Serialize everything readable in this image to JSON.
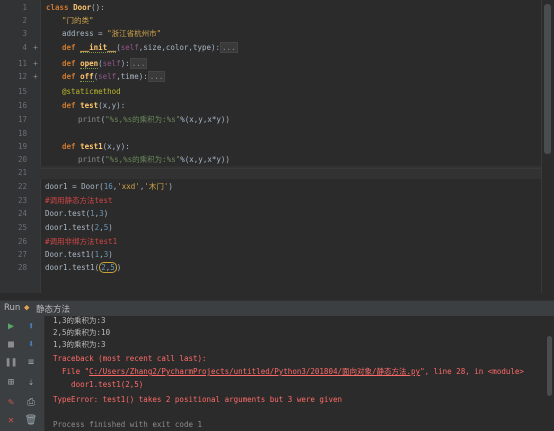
{
  "editor": {
    "line_numbers": [
      "1",
      "2",
      "3",
      "4",
      "11",
      "12",
      "15",
      "16",
      "17",
      "18",
      "19",
      "20",
      "21",
      "22",
      "23",
      "24",
      "25",
      "26",
      "27",
      "28"
    ],
    "lines": {
      "l1": {
        "kw": "class",
        "name": "Door",
        "rest": "():"
      },
      "l2": {
        "text": "\"门的类\""
      },
      "l3": {
        "name": "address",
        "eq": " = ",
        "val": "\"浙江省杭州市\""
      },
      "l4": {
        "kw": "def",
        "name": "__init__",
        "open": "(",
        "self": "self",
        "args": ",size,color,type):",
        "fold": "..."
      },
      "l11": {
        "kw": "def",
        "name": "open",
        "open": "(",
        "self": "self",
        "close": "):",
        "fold": "..."
      },
      "l12": {
        "kw": "def",
        "name": "off",
        "open": "(",
        "self": "self",
        "args": ",time):",
        "fold": "..."
      },
      "l15": {
        "text": "@staticmethod"
      },
      "l16": {
        "kw": "def",
        "name": "test",
        "args": "(x,y):"
      },
      "l17": {
        "fn": "print",
        "open": "(",
        "str": "\"%s,%s的乘积为:%s\"",
        "rest": "%(x,y,x*y))"
      },
      "l19": {
        "kw": "def",
        "name": "test1",
        "args": "(x,y):"
      },
      "l20": {
        "fn": "print",
        "open": "(",
        "str": "\"%s,%s的乘积为:%s\"",
        "rest": "%(x,y,x*y))"
      },
      "l22": {
        "lhs": "door1 = Door(",
        "num": "16",
        "c1": ",",
        "s1": "'xxd'",
        "c2": ",",
        "s2": "'木门'",
        "close": ")"
      },
      "l23": {
        "text": "#调用静态方法test"
      },
      "l24": {
        "a": "Door.test(",
        "n1": "1",
        "c": ",",
        "n2": "3",
        "b": ")"
      },
      "l25": {
        "a": "door1.test(",
        "n1": "2",
        "c": ",",
        "n2": "5",
        "b": ")"
      },
      "l26": {
        "text": "#调用非绑方法test1"
      },
      "l27": {
        "a": "Door.test1(",
        "n1": "1",
        "c": ",",
        "n2": "3",
        "b": ")"
      },
      "l28": {
        "a": "door1.test1(",
        "n1": "2",
        "c": ",",
        "n2": "5",
        "b": ")"
      }
    },
    "fold_markers": {
      "plus": "+"
    }
  },
  "run_panel": {
    "label": "Run",
    "tab_title": "静态方法",
    "output": [
      "1,3的乘积为:3",
      "2,5的乘积为:10",
      "1,3的乘积为:3"
    ],
    "traceback_head": "Traceback (most recent call last):",
    "trace_file_prefix": "  File \"",
    "trace_file_path": "C:/Users/Zhang2/PycharmProjects/untitled/Python3/201804/面向对象/静态方法.py",
    "trace_file_suffix": "\", line 28, in <module>",
    "trace_code": "    door1.test1(2,5)",
    "error": "TypeError: test1() takes 2 positional arguments but 3 were given",
    "finished": "Process finished with exit code 1"
  },
  "toolbar_icons": [
    "run-icon",
    "rerun-icon",
    "stop-icon",
    "pause-icon",
    "up-arrow-icon",
    "down-arrow-icon",
    "soft-wrap-icon",
    "scroll-to-end-icon",
    "print-icon",
    "pin-icon",
    "trash-icon",
    "close-icon"
  ],
  "colors": {
    "bg": "#2b2b2b",
    "gutter": "#313335",
    "keyword": "#cc7832",
    "function": "#ffc66d",
    "string": "#6a8759",
    "error": "#ff6b68"
  }
}
